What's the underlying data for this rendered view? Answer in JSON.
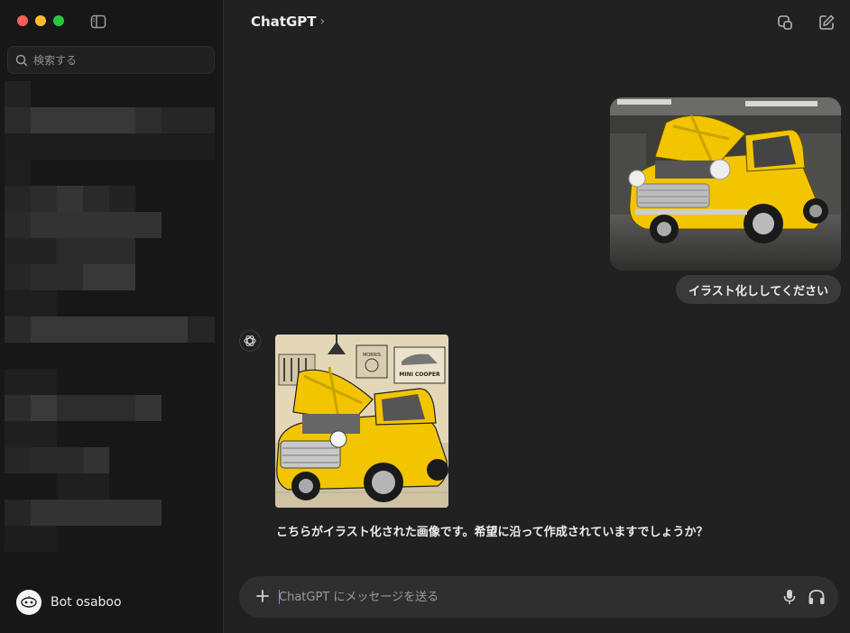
{
  "sidebar": {
    "search_placeholder": "検索する",
    "user_name": "Bot osaboo",
    "avatar_text": "ᗣᗣ"
  },
  "header": {
    "title": "ChatGPT",
    "chevron": "›"
  },
  "conversation": {
    "user_message": "イラスト化ししてください",
    "assistant_message": "こちらがイラスト化された画像です。希望に沿って作成されていますでしょうか？",
    "illustration_signs": {
      "sign_left": "MORRIS",
      "sign_right": "MINI COOPER"
    }
  },
  "composer": {
    "placeholder": "ChatGPT にメッセージを送る"
  },
  "colors": {
    "sidebar_bg": "#171717",
    "main_bg": "#212121",
    "bubble_bg": "#3a3a3a",
    "composer_bg": "#2f2f2f",
    "car_yellow": "#f2c500"
  }
}
